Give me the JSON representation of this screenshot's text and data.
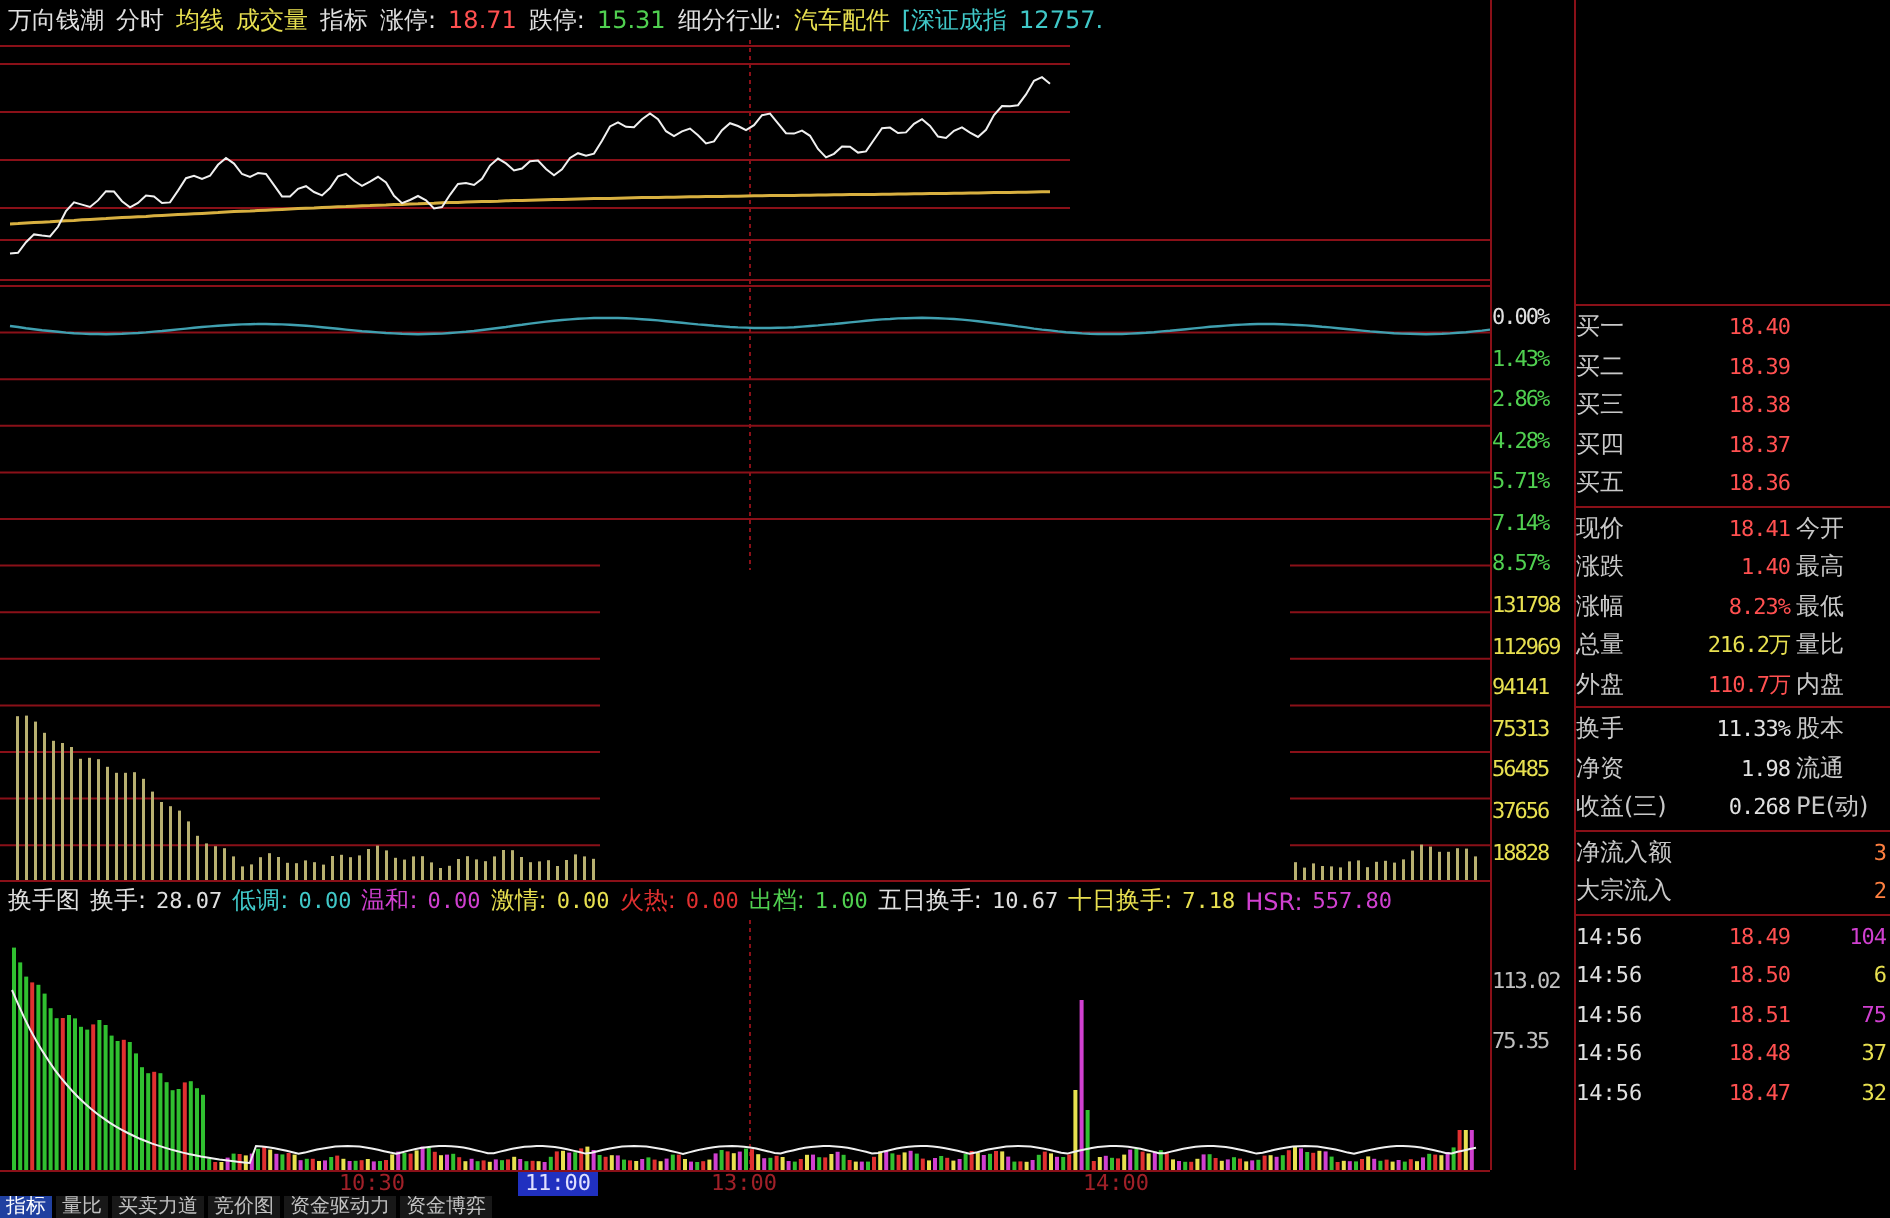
{
  "header": {
    "items": [
      {
        "text": "万向钱潮",
        "color": "#e0e0e0"
      },
      {
        "text": "分时",
        "color": "#e0e0e0"
      },
      {
        "text": "均线",
        "color": "#e8e050"
      },
      {
        "text": "成交量",
        "color": "#e8e050"
      },
      {
        "text": "指标",
        "color": "#e0e0e0"
      },
      {
        "text": "涨停:",
        "color": "#e0e0e0"
      },
      {
        "text": "18.71",
        "color": "#ff5050"
      },
      {
        "text": "跌停:",
        "color": "#e0e0e0"
      },
      {
        "text": "15.31",
        "color": "#50d050"
      },
      {
        "text": "细分行业:",
        "color": "#e0e0e0"
      },
      {
        "text": "汽车配件",
        "color": "#e8e050"
      },
      {
        "text": "[深证成指",
        "color": "#40c8c8"
      },
      {
        "text": "12757.",
        "color": "#40c8c8"
      }
    ]
  },
  "price_axis": {
    "labels": [
      {
        "text": "0.00%",
        "color": "#e0e0e0"
      },
      {
        "text": "1.43%",
        "color": "#50d050"
      },
      {
        "text": "2.86%",
        "color": "#50d050"
      },
      {
        "text": "4.28%",
        "color": "#50d050"
      },
      {
        "text": "5.71%",
        "color": "#50d050"
      },
      {
        "text": "7.14%",
        "color": "#50d050"
      },
      {
        "text": "8.57%",
        "color": "#50d050"
      },
      {
        "text": "131798",
        "color": "#e8e050"
      },
      {
        "text": "112969",
        "color": "#e8e050"
      },
      {
        "text": "94141",
        "color": "#e8e050"
      },
      {
        "text": "75313",
        "color": "#e8e050"
      },
      {
        "text": "56485",
        "color": "#e8e050"
      },
      {
        "text": "37656",
        "color": "#e8e050"
      },
      {
        "text": "18828",
        "color": "#e8e050"
      }
    ]
  },
  "quote_panel": {
    "sections": [
      [
        {
          "kind": "quote",
          "label": "买一",
          "value": "18.40",
          "color": "#ff5050"
        },
        {
          "kind": "quote",
          "label": "买二",
          "value": "18.39",
          "color": "#ff5050"
        },
        {
          "kind": "quote",
          "label": "买三",
          "value": "18.38",
          "color": "#ff5050"
        },
        {
          "kind": "quote",
          "label": "买四",
          "value": "18.37",
          "color": "#ff5050"
        },
        {
          "kind": "quote",
          "label": "买五",
          "value": "18.36",
          "color": "#ff5050"
        }
      ],
      [
        {
          "kind": "quote",
          "label": "现价",
          "value": "18.41",
          "color": "#ff5050",
          "label2": "今开"
        },
        {
          "kind": "quote",
          "label": "涨跌",
          "value": "1.40",
          "color": "#ff5050",
          "label2": "最高"
        },
        {
          "kind": "quote",
          "label": "涨幅",
          "value": "8.23%",
          "color": "#ff5050",
          "label2": "最低"
        },
        {
          "kind": "quote",
          "label": "总量",
          "value": "216.2万",
          "color": "#e8e050",
          "label2": "量比"
        },
        {
          "kind": "quote",
          "label": "外盘",
          "value": "110.7万",
          "color": "#ff5050",
          "label2": "内盘"
        }
      ],
      [
        {
          "kind": "quote",
          "label": "换手",
          "value": "11.33%",
          "color": "#e0e0e0",
          "label2": "股本"
        },
        {
          "kind": "quote",
          "label": "净资",
          "value": "1.98",
          "color": "#e0e0e0",
          "label2": "流通"
        },
        {
          "kind": "quote",
          "label": "收益(三)",
          "value": "0.268",
          "color": "#e0e0e0",
          "label2": "PE(动)"
        }
      ],
      [
        {
          "kind": "flow",
          "label": "净流入额",
          "value": "3",
          "color": "#ff8040"
        },
        {
          "kind": "flow",
          "label": "大宗流入",
          "value": "2",
          "color": "#ff8040"
        }
      ],
      [
        {
          "kind": "tick",
          "time": "14:56",
          "price": "18.49",
          "volume": "104",
          "color": "#d040d0"
        },
        {
          "kind": "tick",
          "time": "14:56",
          "price": "18.50",
          "volume": "6",
          "color": "#e8e050"
        },
        {
          "kind": "tick",
          "time": "14:56",
          "price": "18.51",
          "volume": "75",
          "color": "#d040d0"
        },
        {
          "kind": "tick",
          "time": "14:56",
          "price": "18.48",
          "volume": "37",
          "color": "#e8e050"
        },
        {
          "kind": "tick",
          "time": "14:56",
          "price": "18.47",
          "volume": "32",
          "color": "#e8e050"
        }
      ]
    ]
  },
  "indicator": {
    "title": "换手图",
    "items": [
      {
        "label": "换手:",
        "value": "28.07",
        "color": "#e0e0e0"
      },
      {
        "label": "低调:",
        "value": "0.00",
        "color": "#40c8c8"
      },
      {
        "label": "温和:",
        "value": "0.00",
        "color": "#d040d0"
      },
      {
        "label": "激情:",
        "value": "0.00",
        "color": "#e8e050"
      },
      {
        "label": "火热:",
        "value": "0.00",
        "color": "#e03030"
      },
      {
        "label": "出档:",
        "value": "1.00",
        "color": "#50d050"
      },
      {
        "label": "五日换手:",
        "value": "10.67",
        "color": "#e0e0e0"
      },
      {
        "label": "十日换手:",
        "value": "7.18",
        "color": "#e8e050"
      },
      {
        "label": "HSR:",
        "value": "557.80",
        "color": "#d040d0"
      }
    ]
  },
  "indicator_axis": {
    "labels": [
      "113.02",
      "75.35"
    ]
  },
  "time_axis": [
    {
      "label": "10:30",
      "selected": false
    },
    {
      "label": "11:00",
      "selected": true
    },
    {
      "label": "13:00",
      "selected": false
    },
    {
      "label": "14:00",
      "selected": false
    }
  ],
  "tabs": [
    {
      "label": "指标",
      "selected": true
    },
    {
      "label": "量比",
      "selected": false
    },
    {
      "label": "买卖力道",
      "selected": false
    },
    {
      "label": "竞价图",
      "selected": false
    },
    {
      "label": "资金驱动力",
      "selected": false
    },
    {
      "label": "资金博弈",
      "selected": false
    }
  ]
}
